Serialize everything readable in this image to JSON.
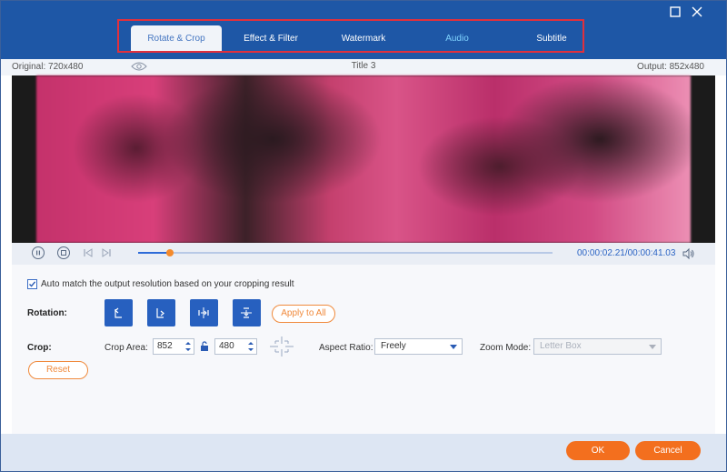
{
  "tabs": [
    {
      "label": "Rotate & Crop"
    },
    {
      "label": "Effect & Filter"
    },
    {
      "label": "Watermark"
    },
    {
      "label": "Audio"
    },
    {
      "label": "Subtitle"
    }
  ],
  "info": {
    "original": "Original: 720x480",
    "title": "Title 3",
    "output": "Output: 852x480"
  },
  "player": {
    "time": "00:00:02.21/00:00:41.03",
    "progress_fraction": 0.076
  },
  "options": {
    "auto_match_label": "Auto match the output resolution based on your cropping result",
    "auto_match_checked": true
  },
  "rotation": {
    "label": "Rotation:",
    "apply_label": "Apply to All"
  },
  "crop": {
    "label": "Crop:",
    "area_label": "Crop Area:",
    "width": "852",
    "height": "480",
    "aspect_label": "Aspect Ratio:",
    "aspect_value": "Freely",
    "zoom_label": "Zoom Mode:",
    "zoom_value": "Letter Box",
    "reset_label": "Reset"
  },
  "footer": {
    "ok_label": "OK",
    "cancel_label": "Cancel"
  },
  "colors": {
    "titlebar": "#1e57a6",
    "accent_orange": "#f36f1e",
    "highlight_red": "#e0303d"
  }
}
